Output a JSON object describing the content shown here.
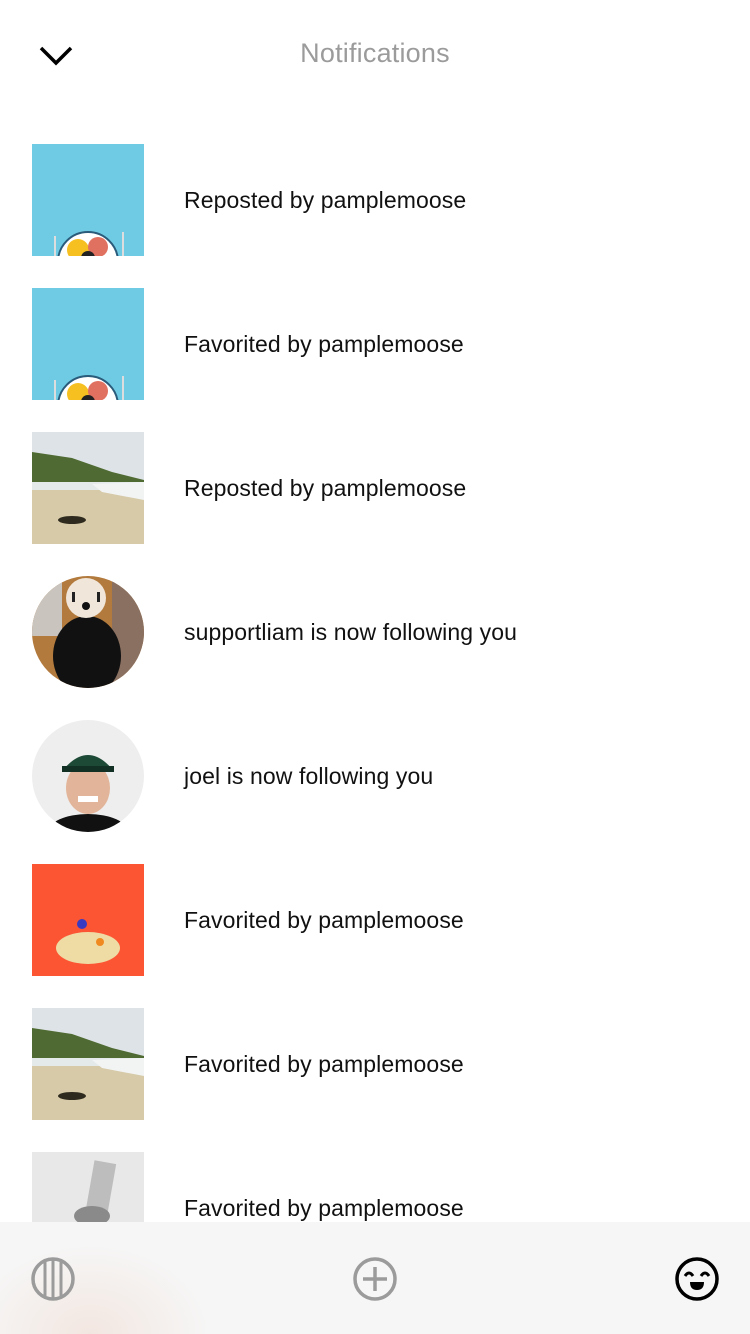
{
  "header": {
    "title": "Notifications",
    "back_icon": "chevron-down-icon"
  },
  "notifications": [
    {
      "text": "Reposted by pamplemoose",
      "thumbnail": "food-plate-blue",
      "shape": "square"
    },
    {
      "text": "Favorited by pamplemoose",
      "thumbnail": "food-plate-blue",
      "shape": "square"
    },
    {
      "text": "Reposted by pamplemoose",
      "thumbnail": "beach",
      "shape": "square"
    },
    {
      "text": "supportliam is now following you",
      "thumbnail": "dog-avatar",
      "shape": "circle"
    },
    {
      "text": "joel is now following you",
      "thumbnail": "man-cap-avatar",
      "shape": "circle"
    },
    {
      "text": "Favorited by pamplemoose",
      "thumbnail": "popcorn-orange",
      "shape": "square"
    },
    {
      "text": "Favorited by pamplemoose",
      "thumbnail": "beach",
      "shape": "square"
    },
    {
      "text": "Favorited by pamplemoose",
      "thumbnail": "hand-grayscale",
      "shape": "square"
    }
  ],
  "tabbar": {
    "items": [
      {
        "name": "feed",
        "icon": "columns-circle-icon",
        "active": false
      },
      {
        "name": "create",
        "icon": "plus-circle-icon",
        "active": false
      },
      {
        "name": "profile",
        "icon": "smiley-face-icon",
        "active": true
      }
    ],
    "colors": {
      "active": "#000000",
      "inactive": "#9b9b9b"
    }
  }
}
